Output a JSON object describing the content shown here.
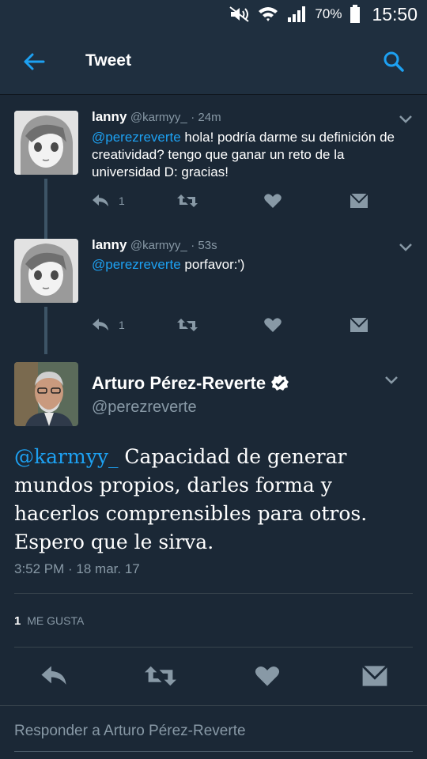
{
  "status_bar": {
    "battery": "70%",
    "time": "15:50",
    "icons": [
      "mute-icon",
      "wifi-icon",
      "signal-icon",
      "battery-icon"
    ]
  },
  "header": {
    "title": "Tweet",
    "back_icon": "arrow-left-icon",
    "search_icon": "search-icon",
    "accent": "#1da1f2"
  },
  "thread": [
    {
      "name": "lanny",
      "handle": "@karmyy_",
      "time": "· 24m",
      "mention": "@perezreverte",
      "text": " hola! podría darme su definición de creatividad? tengo que ganar un reto de la universidad D: gracias!",
      "reply_count": "1"
    },
    {
      "name": "lanny",
      "handle": "@karmyy_",
      "time": "· 53s",
      "mention": "@perezreverte",
      "text": " porfavor:')",
      "reply_count": "1"
    }
  ],
  "main_tweet": {
    "name": "Arturo Pérez-Reverte",
    "handle": "@perezreverte",
    "mention": "@karmyy_",
    "text": " Capacidad de generar mundos propios, darles forma y hacerlos comprensibles para otros. Espero que le sirva.",
    "timestamp": "3:52 PM · 18 mar. 17",
    "likes_count": "1",
    "likes_label": "ME GUSTA",
    "verified_icon": "verified-badge-icon"
  },
  "reply": {
    "placeholder": "Responder a Arturo Pérez-Reverte"
  },
  "colors": {
    "background": "#1b2836",
    "header": "#1f2f3f",
    "secondary_text": "#8899a6",
    "link": "#1da1f2"
  }
}
